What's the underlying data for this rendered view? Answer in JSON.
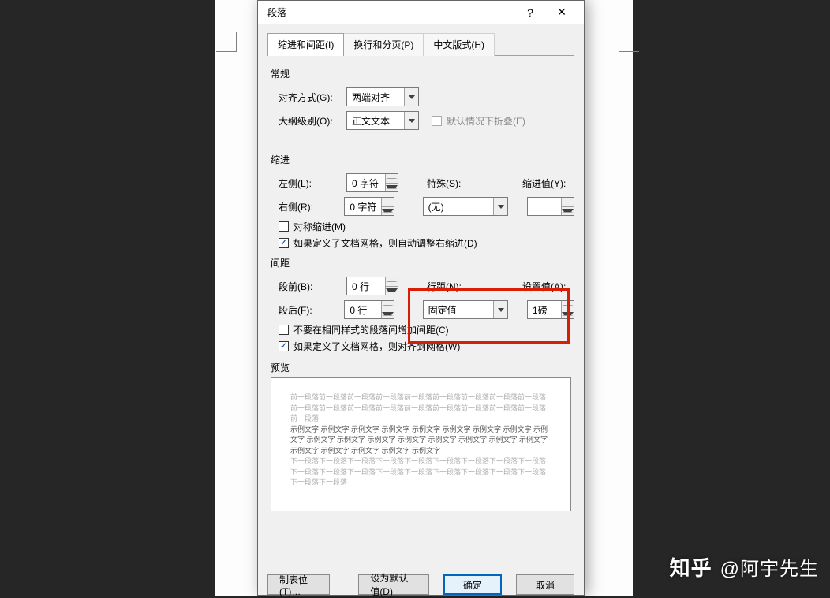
{
  "dialog": {
    "title": "段落",
    "help_icon": "?",
    "close_icon": "✕"
  },
  "tabs": {
    "t1": "缩进和间距(I)",
    "t2": "换行和分页(P)",
    "t3": "中文版式(H)"
  },
  "general": {
    "title": "常规",
    "align_label": "对齐方式(G):",
    "align_value": "两端对齐",
    "outline_label": "大纲级别(O):",
    "outline_value": "正文文本",
    "collapse_label": "默认情况下折叠(E)"
  },
  "indent": {
    "title": "缩进",
    "left_label": "左侧(L):",
    "left_value": "0 字符",
    "right_label": "右侧(R):",
    "right_value": "0 字符",
    "special_label": "特殊(S):",
    "special_value": "(无)",
    "by_label": "缩进值(Y):",
    "by_value": "",
    "mirror_label": "对称缩进(M)",
    "grid_label": "如果定义了文档网格，则自动调整右缩进(D)"
  },
  "spacing": {
    "title": "间距",
    "before_label": "段前(B):",
    "before_value": "0 行",
    "after_label": "段后(F):",
    "after_value": "0 行",
    "line_label": "行距(N):",
    "line_value": "固定值",
    "at_label": "设置值(A):",
    "at_value": "1磅",
    "nosame_label": "不要在相同样式的段落间增加间距(C)",
    "snap_label": "如果定义了文档网格，则对齐到网格(W)"
  },
  "preview": {
    "title": "预览",
    "faded1": "前一段落前一段落前一段落前一段落前一段落前一段落前一段落前一段落前一段落前一段落前一段落前一段落前一段落前一段落前一段落前一段落前一段落前一段落前一段落",
    "sample": "示例文字 示例文字 示例文字 示例文字 示例文字 示例文字 示例文字 示例文字 示例文字 示例文字 示例文字 示例文字 示例文字 示例文字 示例文字 示例文字 示例文字 示例文字 示例文字 示例文字 示例文字 示例文字",
    "faded2": "下一段落下一段落下一段落下一段落下一段落下一段落下一段落下一段落下一段落下一段落下一段落下一段落下一段落下一段落下一段落下一段落下一段落下一段落下一段落下一段落"
  },
  "buttons": {
    "tabs": "制表位(T)…",
    "default": "设为默认值(D)",
    "ok": "确定",
    "cancel": "取消"
  },
  "watermark": {
    "logo": "知乎",
    "author": "@阿宇先生"
  }
}
